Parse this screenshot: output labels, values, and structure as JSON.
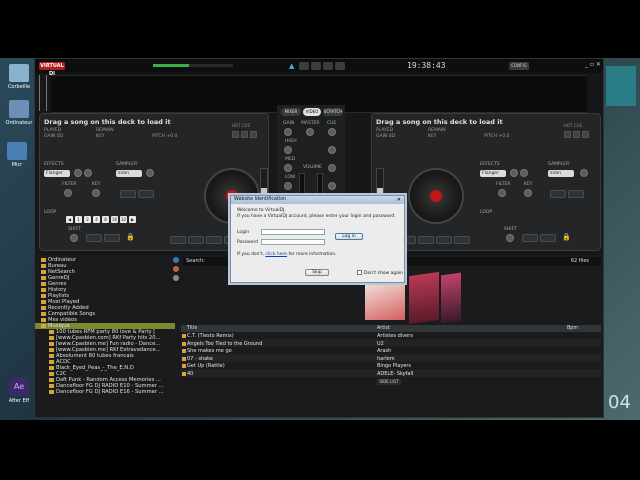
{
  "desktop": {
    "icons": [
      {
        "label": "Corbeille"
      },
      {
        "label": "Ordinateur"
      },
      {
        "label": "Micr"
      },
      {
        "label": "Ae"
      },
      {
        "label": "After Eff"
      }
    ],
    "right_text": "04"
  },
  "app": {
    "logo": "VIRTUAL DJ",
    "clock": "19:38:43",
    "config_label": "CONFIG"
  },
  "deck_left": {
    "title": "Drag a song on this deck to load it",
    "played": "PLAYED",
    "gain": "GAIN 0D",
    "remain": "REMAIN",
    "key": "KEY",
    "pitch": "PITCH +0.0",
    "hotcue": "HOT CUE",
    "effects": "EFFECTS",
    "effect_value": "Flanger",
    "sampler": "SAMPLER",
    "sampler_value": "siren",
    "filter": "FILTER",
    "key_knob": "KEY",
    "loop": "LOOP",
    "loop_values": [
      "1",
      "2",
      "4",
      "8",
      "16",
      "32"
    ],
    "shift": "SHIFT"
  },
  "deck_right": {
    "title": "Drag a song on this deck to load it",
    "played": "PLAYED",
    "gain": "GAIN 0D",
    "remain": "REMAIN",
    "key": "KEY",
    "pitch": "PITCH +0.0",
    "hotcue": "HOT CUE",
    "effects": "EFFECTS",
    "effect_value": "Flanger",
    "sampler": "SAMPLER",
    "sampler_value": "siren",
    "filter": "FILTER",
    "key_knob": "KEY",
    "loop": "LOOP",
    "shift": "SHIFT"
  },
  "mixer": {
    "tabs": [
      "MIXER",
      "VIDEO",
      "SCRATCH"
    ],
    "active_tab": "VIDEO",
    "labels": {
      "gain": "GAIN",
      "master": "MASTER",
      "cue": "CUE",
      "high": "HIGH",
      "med": "MED",
      "low": "LOW",
      "volume": "VOLUME"
    }
  },
  "browser": {
    "search_label": "Search:",
    "file_count": "62 files",
    "tree": [
      "Ordinateur",
      "Bureau",
      "NetSearch",
      "GenreDJ",
      "Genres",
      "History",
      "Playlists",
      "Most Played",
      "Recently Added",
      "Compatible Songs",
      "Mes vidéos",
      "Musique",
      "100 tubes RFM party 80 love & Party [",
      "[www.Cpasbien.com] RKf Party hits 20...",
      "[www.Cpasbien.me] Fun radio - Dance...",
      "[www.Cpasbien.me] RKf Extravadance...",
      "Absolument 80 tubes francais",
      "ACDC",
      "Black_Eyed_Peas_-_The_E.N.D",
      "C2C",
      "Daft Punk - Random Access Memories ...",
      "Dancefloor FG DJ RADIO E10 - Summer ...",
      "Dancefloor FG DJ RADIO E16 - Summer ..."
    ],
    "selected_tree_index": 11,
    "columns": {
      "title": "Title",
      "artist": "Artist",
      "bpm": "Bpm"
    },
    "rows": [
      {
        "title": "C.T. (Tiesto Remix)",
        "artist": "Artistes divers"
      },
      {
        "title": "Angels Too Tied to the Ground",
        "artist": "U2"
      },
      {
        "title": "She makes me go",
        "artist": "Arash"
      },
      {
        "title": "07 - shake",
        "artist": "harlem"
      },
      {
        "title": "Get Up (Rattle)",
        "artist": "Bingo Players"
      },
      {
        "title": "40",
        "artist": "ADELE- Skyfall"
      }
    ],
    "side_list_label": "SIDE LIST"
  },
  "dialog": {
    "title": "Website Identification",
    "welcome": "Welcome to VirtualDJ.",
    "intro": "If you have a VirtualDJ account, please enter your login and password.",
    "login_label": "Login",
    "password_label": "Password",
    "login_value": "",
    "password_value": "",
    "login_button": "Log in",
    "noaccount_prefix": "If you don't,",
    "noaccount_link": "click here",
    "noaccount_suffix": "for more information.",
    "skip_button": "Skip",
    "dont_show": "Don't show again"
  },
  "colors": {
    "accent_red": "#c0171b",
    "browser_bg": "#1a1b1c",
    "deck_bg": "#232527"
  }
}
